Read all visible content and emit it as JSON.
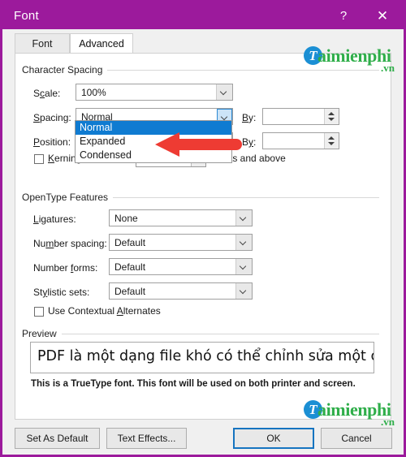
{
  "window": {
    "title": "Font",
    "help_label": "?",
    "close_label": "✕",
    "titlebar_color": "#9c1a9c"
  },
  "tabs": [
    {
      "id": "font",
      "label": "Font",
      "active": false
    },
    {
      "id": "advanced",
      "label": "Advanced",
      "active": true
    }
  ],
  "character_spacing": {
    "group_label": "Character Spacing",
    "scale": {
      "label": "Scale:",
      "value": "100%"
    },
    "spacing": {
      "label": "Spacing:",
      "value": "Normal",
      "by_label": "By:",
      "by_value": "",
      "expanded": true,
      "options": [
        {
          "label": "Normal",
          "selected": true
        },
        {
          "label": "Expanded",
          "selected": false
        },
        {
          "label": "Condensed",
          "selected": false
        }
      ]
    },
    "position": {
      "label": "Position:",
      "value": "",
      "by_label": "By:",
      "by_value": ""
    },
    "kerning": {
      "label": "Kerning for fonts:",
      "checked": false,
      "size_value": "",
      "suffix_label": "Points and above"
    }
  },
  "opentype": {
    "group_label": "OpenType Features",
    "rows": [
      {
        "label": "Ligatures:",
        "value": "None"
      },
      {
        "label": "Number spacing:",
        "value": "Default"
      },
      {
        "label": "Number forms:",
        "value": "Default"
      },
      {
        "label": "Stylistic sets:",
        "value": "Default"
      }
    ],
    "contextual_alternates": {
      "label": "Use Contextual Alternates",
      "checked": false
    }
  },
  "preview": {
    "group_label": "Preview",
    "text": "PDF là một dạng file khó có thể chỉnh sửa một cách t",
    "note": "This is a TrueType font. This font will be used on both printer and screen."
  },
  "footer": {
    "set_as_default": "Set As Default",
    "text_effects": "Text Effects...",
    "ok": "OK",
    "cancel": "Cancel"
  },
  "annotation": {
    "arrow_color": "#ee3b33",
    "arrow_direction": "left"
  },
  "watermarks": [
    {
      "badge": "T",
      "name": "aimienphi",
      "suffix": ".vn"
    },
    {
      "badge": "T",
      "name": "aimienphi",
      "suffix": ".vn"
    }
  ]
}
